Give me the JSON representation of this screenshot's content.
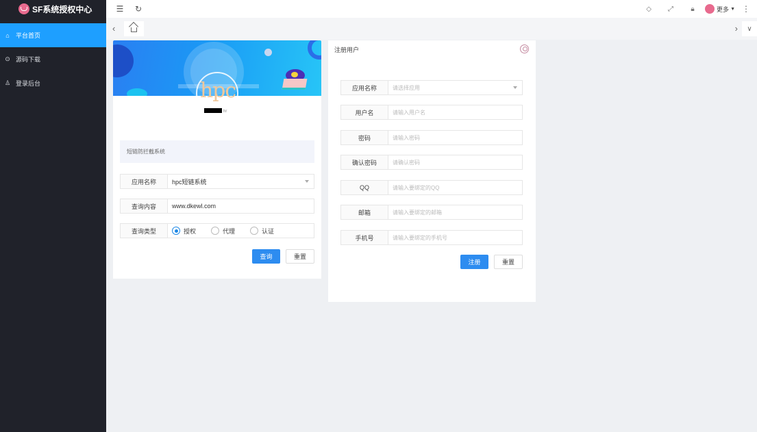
{
  "app": {
    "brand": "SF系统授权中心"
  },
  "sidebar": {
    "items": [
      {
        "label": "平台首页",
        "active": true
      },
      {
        "label": "源码下载",
        "active": false
      },
      {
        "label": "登录后台",
        "active": false
      }
    ]
  },
  "header": {
    "more_label": "更多"
  },
  "left_card": {
    "logo_text": "hpc",
    "description": "短链防拦截系统",
    "app_name_label": "应用名称",
    "app_name_value": "hpc短链系统",
    "query_content_label": "查询内容",
    "query_content_value": "www.dkewl.com",
    "query_type_label": "查询类型",
    "query_types": [
      "授权",
      "代理",
      "认证"
    ],
    "query_type_selected": "授权",
    "query_button": "查询",
    "reset_button": "重置"
  },
  "register": {
    "title": "注册用户",
    "fields": [
      {
        "label": "应用名称",
        "placeholder": "请选择应用"
      },
      {
        "label": "用户名",
        "placeholder": "请输入用户名"
      },
      {
        "label": "密码",
        "placeholder": "请输入密码"
      },
      {
        "label": "确认密码",
        "placeholder": "请确认密码"
      },
      {
        "label": "QQ",
        "placeholder": "请输入要绑定的QQ"
      },
      {
        "label": "邮箱",
        "placeholder": "请输入要绑定的邮箱"
      },
      {
        "label": "手机号",
        "placeholder": "请输入要绑定的手机号"
      }
    ],
    "register_button": "注册",
    "reset_button": "重置"
  },
  "colors": {
    "sidebar_bg": "#20222a",
    "active_nav": "#1e9fff",
    "primary_button": "#2d8cf0"
  }
}
